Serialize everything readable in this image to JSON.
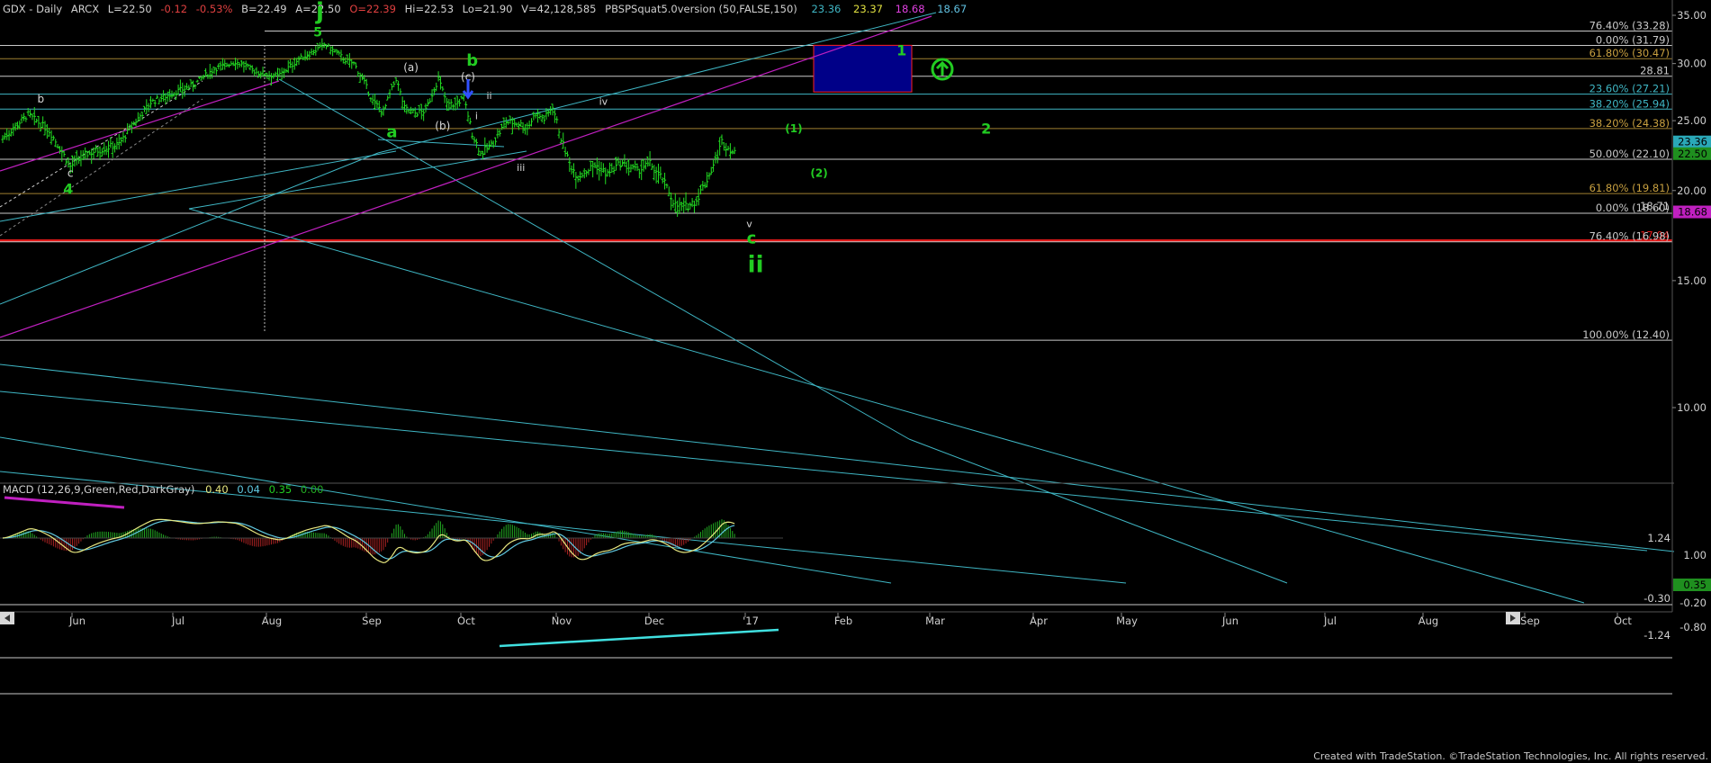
{
  "header": {
    "symbol": "GDX - Daily",
    "exchange": "ARCX",
    "last": "L=22.50",
    "change": "-0.12",
    "change_pct": "-0.53%",
    "bid": "B=22.49",
    "ask": "A=22.50",
    "open": "O=22.39",
    "high": "Hi=22.53",
    "low": "Lo=21.90",
    "volume": "V=42,128,585",
    "indicator": "PBSPSquat5.0version (50,FALSE,150)",
    "ind_values": [
      "23.36",
      "23.37",
      "18.68",
      "18.67"
    ]
  },
  "macd": {
    "label": "MACD (12,26,9,Green,Red,DarkGray)",
    "values": [
      "0.40",
      "0.04",
      "0.35",
      "0.00"
    ]
  },
  "footer": {
    "credit": "Created with TradeStation. ©TradeStation Technologies, Inc. All rights reserved."
  },
  "colors": {
    "background": "#000000",
    "bar": "#22dd22",
    "teal": "#3fb6c4",
    "magenta": "#c020c0",
    "red": "#e01818",
    "white_line": "#c8c8c8",
    "fib_label": "#c9c9c9",
    "orange_label": "#c8a040",
    "label_green": "#22cc22",
    "box_fill": "#000088",
    "box_border": "#ff2020",
    "macd_yellow": "#e8e880",
    "macd_cyan": "#60c8e0",
    "histo_green": "#22aa22",
    "histo_red": "#aa2222"
  },
  "chart_data": {
    "type": "bar",
    "title": "GDX - Daily",
    "ylim": [
      8.4,
      35.6
    ],
    "y_ticks": [
      "35.00",
      "30.00",
      "25.00",
      "20.00",
      "15.00",
      "10.00"
    ],
    "x_months": [
      "Jun",
      "Jul",
      "Aug",
      "Sep",
      "Oct",
      "Nov",
      "Dec",
      "'17",
      "Feb",
      "Mar",
      "Apr",
      "May",
      "Jun",
      "Jul",
      "Aug",
      "Sep",
      "Oct"
    ],
    "price_path": [
      [
        0,
        23.6
      ],
      [
        12,
        25.5
      ],
      [
        22,
        24.2
      ],
      [
        32,
        21.6
      ],
      [
        40,
        22.5
      ],
      [
        55,
        23.2
      ],
      [
        70,
        26.5
      ],
      [
        90,
        28.0
      ],
      [
        100,
        29.5
      ],
      [
        110,
        30.2
      ],
      [
        120,
        29.2
      ],
      [
        130,
        28.8
      ],
      [
        140,
        30.4
      ],
      [
        148,
        31.3
      ],
      [
        152,
        31.9
      ],
      [
        158,
        31.0
      ],
      [
        163,
        30.2
      ],
      [
        166,
        30.0
      ],
      [
        170,
        28.6
      ],
      [
        175,
        26.6
      ],
      [
        180,
        25.7
      ],
      [
        186,
        28.6
      ],
      [
        190,
        26.0
      ],
      [
        195,
        25.6
      ],
      [
        200,
        25.8
      ],
      [
        206,
        28.6
      ],
      [
        210,
        26.4
      ],
      [
        214,
        26.3
      ],
      [
        218,
        26.9
      ],
      [
        222,
        24.0
      ],
      [
        226,
        22.5
      ],
      [
        232,
        23.3
      ],
      [
        238,
        24.9
      ],
      [
        244,
        24.8
      ],
      [
        248,
        24.4
      ],
      [
        252,
        25.6
      ],
      [
        256,
        25.1
      ],
      [
        260,
        26.2
      ],
      [
        264,
        23.6
      ],
      [
        268,
        21.8
      ],
      [
        272,
        20.9
      ],
      [
        280,
        21.7
      ],
      [
        286,
        21.1
      ],
      [
        292,
        21.8
      ],
      [
        300,
        21.3
      ],
      [
        306,
        21.8
      ],
      [
        312,
        20.7
      ],
      [
        318,
        19.1
      ],
      [
        322,
        18.9
      ],
      [
        328,
        19.4
      ],
      [
        334,
        21.0
      ],
      [
        338,
        22.4
      ],
      [
        340,
        23.4
      ],
      [
        342,
        23.0
      ],
      [
        344,
        22.8
      ],
      [
        346,
        22.5
      ]
    ],
    "fib_levels": [
      {
        "label": "76.40% (33.28)",
        "value": 33.28,
        "color": "white"
      },
      {
        "label": "0.00% (31.79)",
        "value": 31.79,
        "color": "white"
      },
      {
        "label": "61.80% (30.47)",
        "value": 30.47,
        "color": "orange"
      },
      {
        "label": "28.81",
        "value": 28.81,
        "color": "white"
      },
      {
        "label": "23.60% (27.21)",
        "value": 27.21,
        "color": "teal"
      },
      {
        "label": "38.20% (25.94)",
        "value": 25.94,
        "color": "teal"
      },
      {
        "label": "38.20% (24.38)",
        "value": 24.38,
        "color": "orange"
      },
      {
        "label": "50.00% (22.10)",
        "value": 22.1,
        "color": "white"
      },
      {
        "label": "61.80% (19.81)",
        "value": 19.81,
        "color": "orange"
      },
      {
        "label": "0.00% (18.60)",
        "value": 18.6,
        "color": "white"
      },
      {
        "label": "18.71",
        "value": 18.71,
        "color": "white"
      },
      {
        "label": "17.04",
        "value": 17.04,
        "color": "red"
      },
      {
        "label": "76.40% (16.98)",
        "value": 16.98,
        "color": "white"
      },
      {
        "label": "100.00% (12.40)",
        "value": 12.4,
        "color": "white"
      }
    ],
    "price_badges": [
      {
        "label": "23.36",
        "value": 23.36,
        "color": "#2aa8b8"
      },
      {
        "label": "22.50",
        "value": 22.5,
        "color": "#1f8f1f"
      },
      {
        "label": "18.68",
        "value": 18.68,
        "color": "#c020c0"
      }
    ],
    "box": {
      "value_top": 31.8,
      "value_bottom": 27.4,
      "label": "1"
    },
    "wave_labels": [
      {
        "text": "j",
        "bar": 150,
        "value": 34.6,
        "size": 26,
        "color": "green"
      },
      {
        "text": "5",
        "bar": 149,
        "value": 32.7,
        "size": 14,
        "color": "green"
      },
      {
        "text": "b",
        "bar": 222,
        "value": 29.8,
        "size": 18,
        "color": "green"
      },
      {
        "text": "(a)",
        "bar": 193,
        "value": 29.3,
        "size": 12,
        "color": "white"
      },
      {
        "text": "(c)",
        "bar": 220,
        "value": 28.4,
        "size": 12,
        "color": "white"
      },
      {
        "text": "ii",
        "bar": 230,
        "value": 26.8,
        "size": 11,
        "color": "white"
      },
      {
        "text": "i",
        "bar": 224,
        "value": 25.1,
        "size": 11,
        "color": "white"
      },
      {
        "text": "a",
        "bar": 184,
        "value": 23.7,
        "size": 18,
        "color": "green"
      },
      {
        "text": "(b)",
        "bar": 208,
        "value": 24.3,
        "size": 12,
        "color": "white"
      },
      {
        "text": "iii",
        "bar": 245,
        "value": 21.3,
        "size": 11,
        "color": "white"
      },
      {
        "text": "iv",
        "bar": 284,
        "value": 26.3,
        "size": 11,
        "color": "white"
      },
      {
        "text": "v",
        "bar": 353,
        "value": 17.8,
        "size": 11,
        "color": "white"
      },
      {
        "text": "c",
        "bar": 354,
        "value": 16.9,
        "size": 18,
        "color": "green"
      },
      {
        "text": "ii",
        "bar": 356,
        "value": 15.4,
        "size": 26,
        "color": "green"
      },
      {
        "text": "(1)",
        "bar": 374,
        "value": 24.1,
        "size": 12,
        "color": "green"
      },
      {
        "text": "(2)",
        "bar": 386,
        "value": 20.9,
        "size": 12,
        "color": "green"
      },
      {
        "text": "b",
        "bar": 18,
        "value": 26.5,
        "size": 12,
        "color": "white"
      },
      {
        "text": "c",
        "bar": 32,
        "value": 20.9,
        "size": 12,
        "color": "white"
      },
      {
        "text": "4",
        "bar": 31,
        "value": 19.8,
        "size": 16,
        "color": "green"
      },
      {
        "text": "1",
        "bar": 425,
        "value": 30.8,
        "size": 16,
        "color": "green"
      },
      {
        "text": "2",
        "bar": 465,
        "value": 24.0,
        "size": 16,
        "color": "green"
      }
    ],
    "macd_ticks": [
      "1.24",
      "1.00",
      "0.35",
      "-0.30",
      "-0.20",
      "-1.24",
      "-0.80"
    ]
  }
}
